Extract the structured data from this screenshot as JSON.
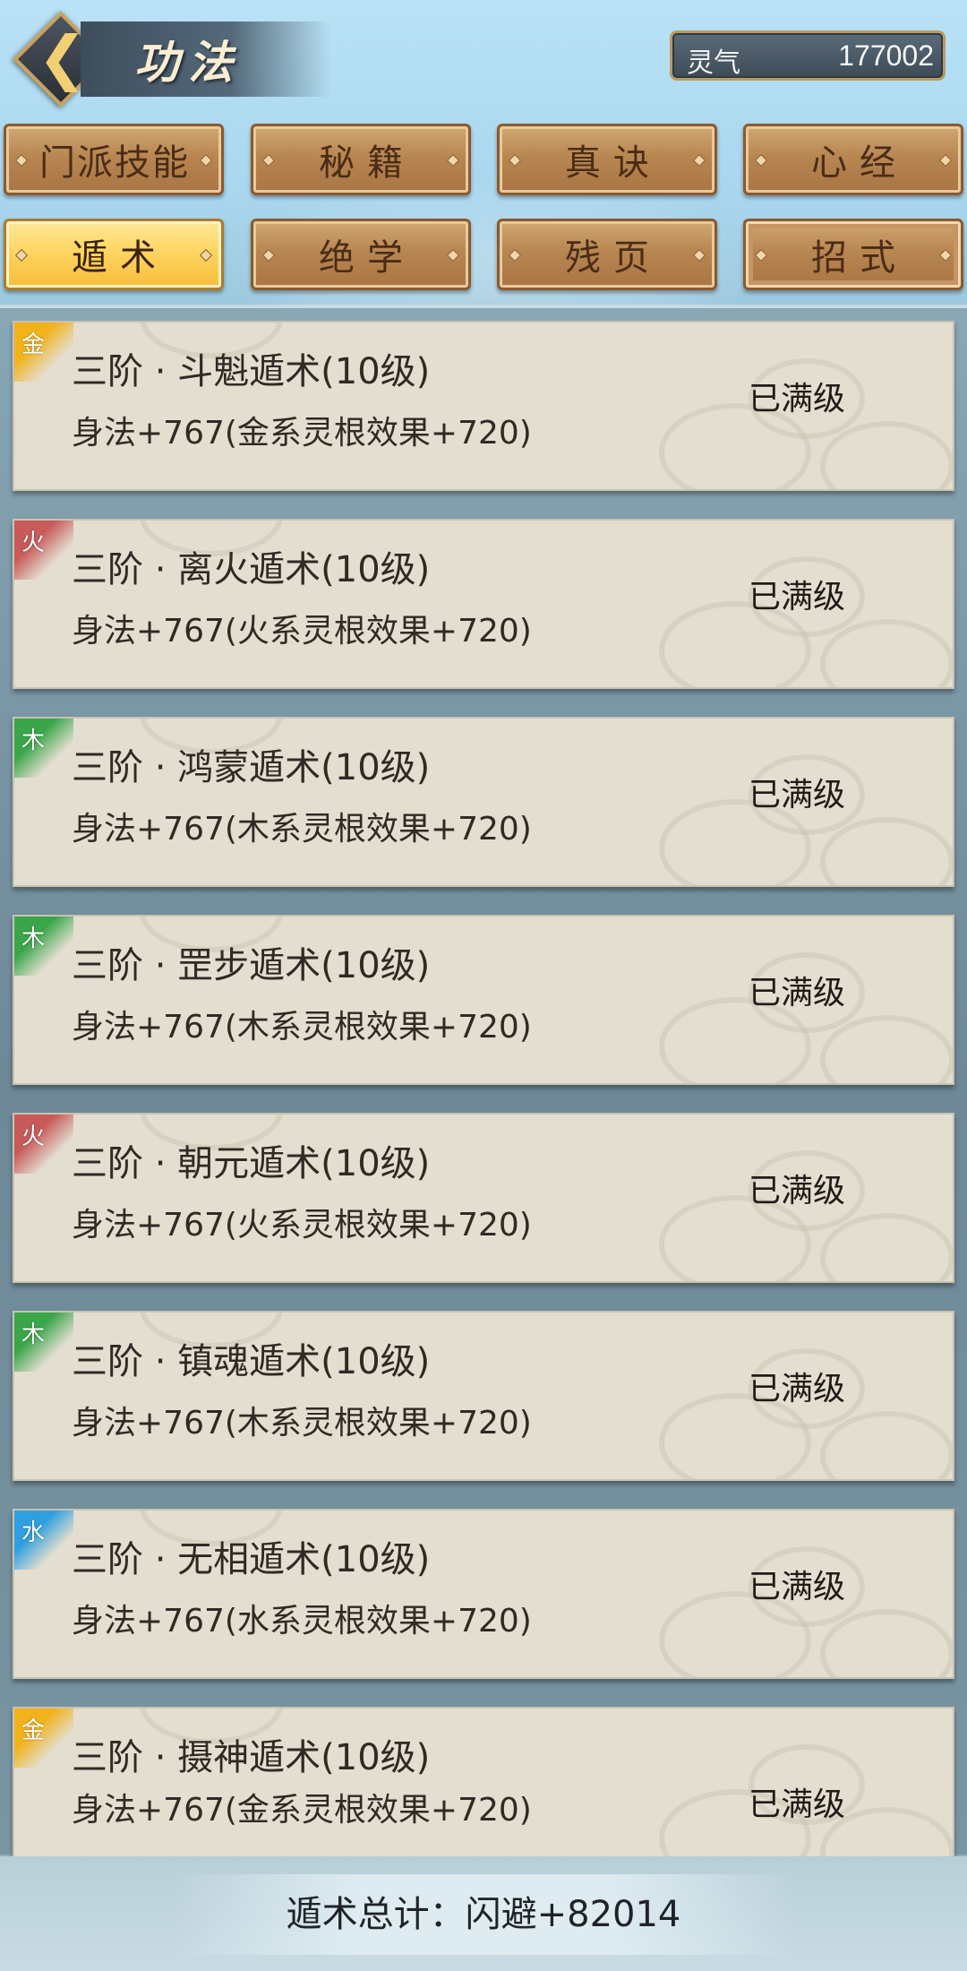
{
  "header": {
    "back_icon": "chevron-left-icon",
    "title": "功法",
    "qi_label": "灵气",
    "qi_value": "177002"
  },
  "tabs": [
    {
      "label": "门派技能",
      "active": false
    },
    {
      "label": "秘籍",
      "active": false
    },
    {
      "label": "真诀",
      "active": false
    },
    {
      "label": "心经",
      "active": false
    },
    {
      "label": "遁术",
      "active": true
    },
    {
      "label": "绝学",
      "active": false
    },
    {
      "label": "残页",
      "active": false
    },
    {
      "label": "招式",
      "active": false
    }
  ],
  "skills": [
    {
      "element": "金",
      "name": "三阶 · 斗魁遁术(10级)",
      "effect": "身法+767(金系灵根效果+720)",
      "status": "已满级",
      "color": "#f2b21c"
    },
    {
      "element": "火",
      "name": "三阶 · 离火遁术(10级)",
      "effect": "身法+767(火系灵根效果+720)",
      "status": "已满级",
      "color": "#c85a5a"
    },
    {
      "element": "木",
      "name": "三阶 · 鸿蒙遁术(10级)",
      "effect": "身法+767(木系灵根效果+720)",
      "status": "已满级",
      "color": "#3aa64a"
    },
    {
      "element": "木",
      "name": "三阶 · 罡步遁术(10级)",
      "effect": "身法+767(木系灵根效果+720)",
      "status": "已满级",
      "color": "#3aa64a"
    },
    {
      "element": "火",
      "name": "三阶 · 朝元遁术(10级)",
      "effect": "身法+767(火系灵根效果+720)",
      "status": "已满级",
      "color": "#c85a5a"
    },
    {
      "element": "木",
      "name": "三阶 · 镇魂遁术(10级)",
      "effect": "身法+767(木系灵根效果+720)",
      "status": "已满级",
      "color": "#3aa64a"
    },
    {
      "element": "水",
      "name": "三阶 · 无相遁术(10级)",
      "effect": "身法+767(水系灵根效果+720)",
      "status": "已满级",
      "color": "#2f9fe0"
    },
    {
      "element": "金",
      "name": "三阶 · 摄神遁术(10级)",
      "effect": "身法+767(金系灵根效果+720)",
      "status": "已满级",
      "color": "#f2b21c"
    }
  ],
  "footer": {
    "total_text": "遁术总计：闪避+82014"
  }
}
